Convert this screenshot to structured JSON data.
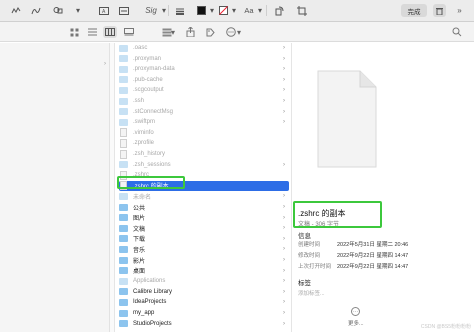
{
  "markup_toolbar": {
    "icons": [
      "sketch-icon",
      "draw-icon",
      "shapes-icon",
      "text-box-icon",
      "sign-icon",
      "line-style-icon",
      "border-color-icon",
      "fill-color-icon",
      "font-icon",
      "rotate-icon",
      "crop-icon"
    ],
    "sign_glyph": "Sig",
    "font_glyph": "Aa",
    "done_label": "完成"
  },
  "finder_toolbar": {
    "views": [
      "icon-view",
      "list-view",
      "column-view",
      "gallery-view"
    ],
    "active_view": "column-view"
  },
  "files": [
    {
      "name": ".oasc",
      "kind": "folder",
      "dim": true
    },
    {
      "name": ".proxyman",
      "kind": "folder",
      "dim": true
    },
    {
      "name": ".proxyman-data",
      "kind": "folder",
      "dim": true
    },
    {
      "name": ".pub-cache",
      "kind": "folder",
      "dim": true
    },
    {
      "name": ".scgcoutput",
      "kind": "folder",
      "dim": true
    },
    {
      "name": ".ssh",
      "kind": "folder",
      "dim": true
    },
    {
      "name": ".stConnectMsg",
      "kind": "folder",
      "dim": true
    },
    {
      "name": ".swiftpm",
      "kind": "folder",
      "dim": true
    },
    {
      "name": ".viminfo",
      "kind": "file",
      "dim": true
    },
    {
      "name": ".zprofile",
      "kind": "file",
      "dim": true
    },
    {
      "name": ".zsh_history",
      "kind": "file",
      "dim": true
    },
    {
      "name": ".zsh_sessions",
      "kind": "folder",
      "dim": true
    },
    {
      "name": ".zshrc",
      "kind": "file",
      "dim": true
    },
    {
      "name": ".zshrc 的副本",
      "kind": "file",
      "dim": false,
      "selected": true
    },
    {
      "name": "未命名",
      "kind": "folder",
      "dim": true
    },
    {
      "name": "公共",
      "kind": "folder",
      "dim": false
    },
    {
      "name": "图片",
      "kind": "folder",
      "dim": false
    },
    {
      "name": "文稿",
      "kind": "folder",
      "dim": false
    },
    {
      "name": "下载",
      "kind": "folder",
      "dim": false
    },
    {
      "name": "音乐",
      "kind": "folder",
      "dim": false
    },
    {
      "name": "影片",
      "kind": "folder",
      "dim": false
    },
    {
      "name": "桌面",
      "kind": "folder",
      "dim": false
    },
    {
      "name": "Applications",
      "kind": "folder",
      "dim": true
    },
    {
      "name": "Calibre Library",
      "kind": "folder",
      "dim": false
    },
    {
      "name": "IdeaProjects",
      "kind": "folder",
      "dim": false
    },
    {
      "name": "my_app",
      "kind": "folder",
      "dim": false
    },
    {
      "name": "StudioProjects",
      "kind": "folder",
      "dim": false
    }
  ],
  "preview": {
    "file_name": ".zshrc 的副本",
    "file_meta": "文稿 - 306 字节",
    "info_heading": "信息",
    "info": [
      {
        "key": "创建时间",
        "value": "2022年5月31日 星期二 20:46"
      },
      {
        "key": "修改时间",
        "value": "2022年9月22日 星期四 14:47"
      },
      {
        "key": "上次打开时间",
        "value": "2022年9月22日 星期四 14:47"
      }
    ],
    "tags_heading": "标签",
    "tags_placeholder": "添加标签...",
    "more_label": "更多..."
  },
  "watermark": "CSDN @BS5粉粉粉粉",
  "colors": {
    "selection": "#2d6de6",
    "highlight_box": "#3cc83c",
    "folder": "#8cc4ee"
  }
}
